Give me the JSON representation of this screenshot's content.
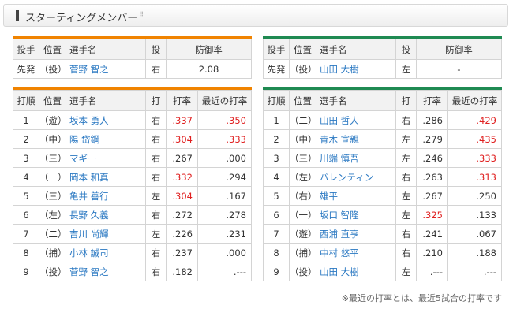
{
  "header": {
    "title": "スターティングメンバー",
    "dots": "⁞⁞"
  },
  "colors": {
    "left_team": "#f08300",
    "right_team": "#1f8a52",
    "link": "#2a78c2",
    "highlight": "#e02020"
  },
  "left": {
    "pitcher_headers": [
      "投手",
      "位置",
      "選手名",
      "投",
      "防御率"
    ],
    "pitcher": {
      "role": "先発",
      "pos": "（投）",
      "name": "菅野 智之",
      "hand": "右",
      "era": "2.08"
    },
    "batter_headers": [
      "打順",
      "位置",
      "選手名",
      "打",
      "打率",
      "最近の打率"
    ],
    "batters": [
      {
        "order": "1",
        "pos": "（遊）",
        "name": "坂本 勇人",
        "hand": "右",
        "avg": ".337",
        "avg_red": true,
        "recent": ".350",
        "recent_red": true
      },
      {
        "order": "2",
        "pos": "（中）",
        "name": "陽 岱鋼",
        "hand": "右",
        "avg": ".304",
        "avg_red": true,
        "recent": ".333",
        "recent_red": true
      },
      {
        "order": "3",
        "pos": "（三）",
        "name": "マギー",
        "hand": "右",
        "avg": ".267",
        "avg_red": false,
        "recent": ".000",
        "recent_red": false
      },
      {
        "order": "4",
        "pos": "（一）",
        "name": "岡本 和真",
        "hand": "右",
        "avg": ".332",
        "avg_red": true,
        "recent": ".294",
        "recent_red": false
      },
      {
        "order": "5",
        "pos": "（三）",
        "name": "亀井 善行",
        "hand": "左",
        "avg": ".304",
        "avg_red": true,
        "recent": ".167",
        "recent_red": false
      },
      {
        "order": "6",
        "pos": "（左）",
        "name": "長野 久義",
        "hand": "右",
        "avg": ".272",
        "avg_red": false,
        "recent": ".278",
        "recent_red": false
      },
      {
        "order": "7",
        "pos": "（二）",
        "name": "吉川 尚輝",
        "hand": "左",
        "avg": ".226",
        "avg_red": false,
        "recent": ".231",
        "recent_red": false
      },
      {
        "order": "8",
        "pos": "（捕）",
        "name": "小林 誠司",
        "hand": "右",
        "avg": ".237",
        "avg_red": false,
        "recent": ".000",
        "recent_red": false
      },
      {
        "order": "9",
        "pos": "（投）",
        "name": "菅野 智之",
        "hand": "右",
        "avg": ".182",
        "avg_red": false,
        "recent": ".---",
        "recent_red": false
      }
    ]
  },
  "right": {
    "pitcher_headers": [
      "投手",
      "位置",
      "選手名",
      "投",
      "防御率"
    ],
    "pitcher": {
      "role": "先発",
      "pos": "（投）",
      "name": "山田 大樹",
      "hand": "左",
      "era": "-"
    },
    "batter_headers": [
      "打順",
      "位置",
      "選手名",
      "打",
      "打率",
      "最近の打率"
    ],
    "batters": [
      {
        "order": "1",
        "pos": "（二）",
        "name": "山田 哲人",
        "hand": "右",
        "avg": ".286",
        "avg_red": false,
        "recent": ".429",
        "recent_red": true
      },
      {
        "order": "2",
        "pos": "（中）",
        "name": "青木 宣親",
        "hand": "左",
        "avg": ".279",
        "avg_red": false,
        "recent": ".435",
        "recent_red": true
      },
      {
        "order": "3",
        "pos": "（三）",
        "name": "川端 慎吾",
        "hand": "左",
        "avg": ".246",
        "avg_red": false,
        "recent": ".333",
        "recent_red": true
      },
      {
        "order": "4",
        "pos": "（左）",
        "name": "バレンティン",
        "hand": "右",
        "avg": ".263",
        "avg_red": false,
        "recent": ".313",
        "recent_red": true
      },
      {
        "order": "5",
        "pos": "（右）",
        "name": "雄平",
        "hand": "左",
        "avg": ".267",
        "avg_red": false,
        "recent": ".250",
        "recent_red": false
      },
      {
        "order": "6",
        "pos": "（一）",
        "name": "坂口 智隆",
        "hand": "左",
        "avg": ".325",
        "avg_red": true,
        "recent": ".133",
        "recent_red": false
      },
      {
        "order": "7",
        "pos": "（遊）",
        "name": "西浦 直亨",
        "hand": "右",
        "avg": ".241",
        "avg_red": false,
        "recent": ".067",
        "recent_red": false
      },
      {
        "order": "8",
        "pos": "（捕）",
        "name": "中村 悠平",
        "hand": "右",
        "avg": ".210",
        "avg_red": false,
        "recent": ".188",
        "recent_red": false
      },
      {
        "order": "9",
        "pos": "（投）",
        "name": "山田 大樹",
        "hand": "左",
        "avg": ".---",
        "avg_red": false,
        "recent": ".---",
        "recent_red": false
      }
    ]
  },
  "note": "※最近の打率とは、最近5試合の打率です"
}
